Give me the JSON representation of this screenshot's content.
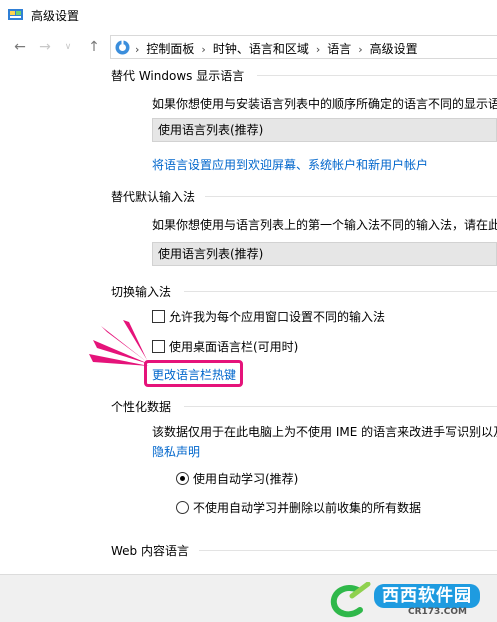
{
  "window": {
    "title": "高级设置",
    "icon": "control-panel-icon"
  },
  "nav": {
    "back": "back-arrow-icon",
    "forward": "forward-arrow-icon",
    "recent": "chevron-down-icon",
    "up": "up-arrow-icon",
    "breadcrumbs": [
      "控制面板",
      "时钟、语言和区域",
      "语言",
      "高级设置"
    ],
    "separator": "›"
  },
  "sections": {
    "display_lang": {
      "heading": "替代 Windows 显示语言",
      "description": "如果你想使用与安装语言列表中的顺序所确定的语言不同的显示语",
      "dropdown_value": "使用语言列表(推荐)",
      "link": "将语言设置应用到欢迎屏幕、系统帐户和新用户帐户"
    },
    "input_method": {
      "heading": "替代默认输入法",
      "description": "如果你想使用与语言列表上的第一个输入法不同的输入法，请在此",
      "dropdown_value": "使用语言列表(推荐)"
    },
    "switch_input": {
      "heading": "切换输入法",
      "option1": "允许我为每个应用窗口设置不同的输入法",
      "option1_checked": false,
      "option2": "使用桌面语言栏(可用时)",
      "option2_checked": false,
      "link": "更改语言栏热键"
    },
    "personalization": {
      "heading": "个性化数据",
      "description": "该数据仅用于在此电脑上为不使用 IME 的语言来改进手写识别以及",
      "privacy_link": "隐私声明",
      "radio1": "使用自动学习(推荐)",
      "radio1_selected": true,
      "radio2": "不使用自动学习并删除以前收集的所有数据",
      "radio2_selected": false
    },
    "web_lang": {
      "heading": "Web 内容语言"
    }
  },
  "colors": {
    "link": "#0066cc",
    "highlight": "#e5137a",
    "watermark_blue": "#1e9be0"
  },
  "watermark": {
    "text": "西西软件园",
    "sub": "CR173.COM"
  }
}
